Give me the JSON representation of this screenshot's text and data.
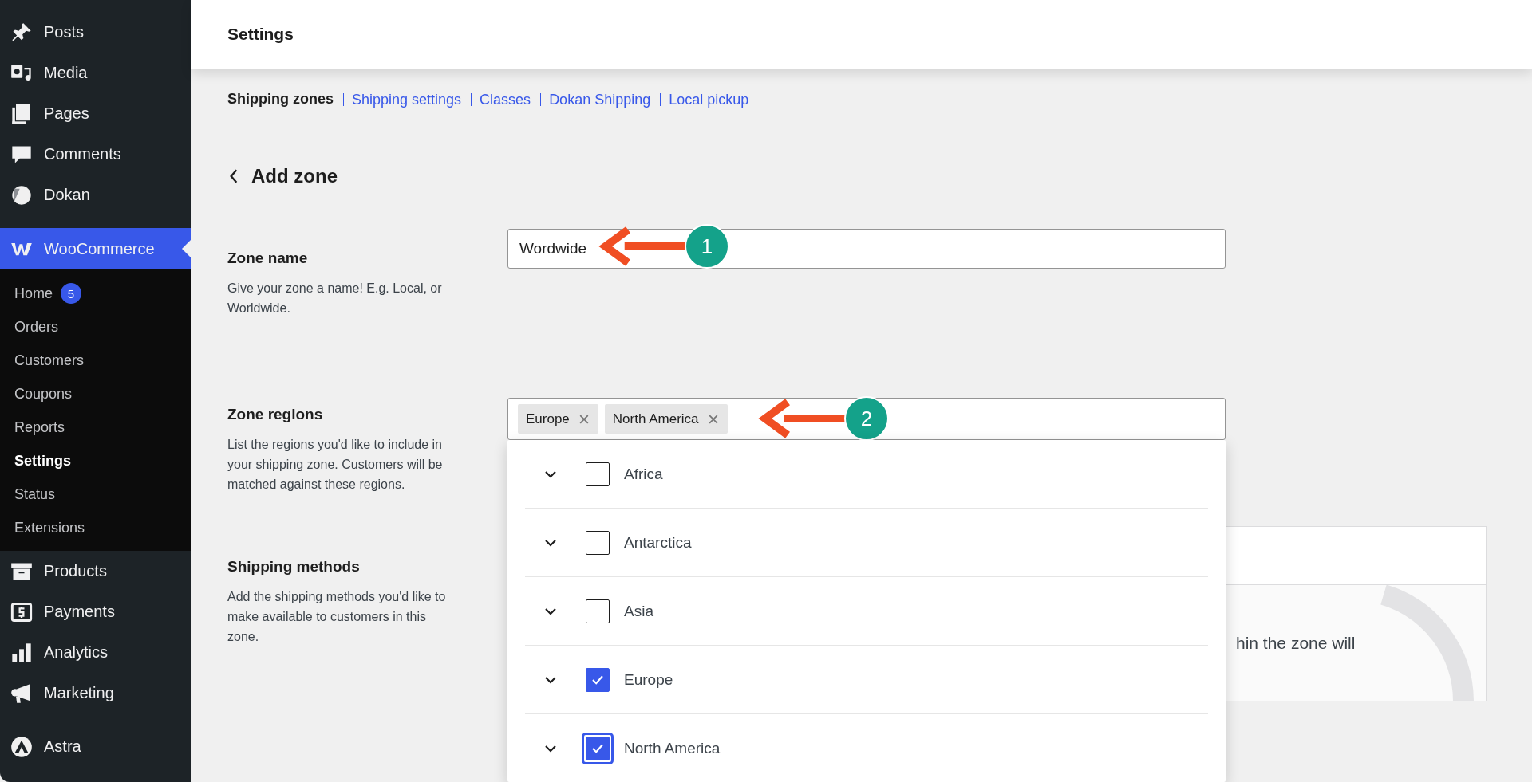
{
  "sidebar": {
    "items": [
      {
        "label": "Posts",
        "selected": false
      },
      {
        "label": "Media",
        "selected": false
      },
      {
        "label": "Pages",
        "selected": false
      },
      {
        "label": "Comments",
        "selected": false
      },
      {
        "label": "Dokan",
        "selected": false
      },
      {
        "label": "WooCommerce",
        "selected": true,
        "children": [
          {
            "label": "Home",
            "badge": "5",
            "selected": false
          },
          {
            "label": "Orders",
            "selected": false
          },
          {
            "label": "Customers",
            "selected": false
          },
          {
            "label": "Coupons",
            "selected": false
          },
          {
            "label": "Reports",
            "selected": false
          },
          {
            "label": "Settings",
            "selected": true
          },
          {
            "label": "Status",
            "selected": false
          },
          {
            "label": "Extensions",
            "selected": false
          }
        ]
      },
      {
        "label": "Products",
        "selected": false
      },
      {
        "label": "Payments",
        "selected": false
      },
      {
        "label": "Analytics",
        "selected": false
      },
      {
        "label": "Marketing",
        "selected": false
      },
      {
        "label": "Astra",
        "selected": false
      }
    ]
  },
  "header": {
    "title": "Settings"
  },
  "tabs": [
    {
      "label": "Shipping zones",
      "selected": true
    },
    {
      "label": "Shipping settings",
      "selected": false
    },
    {
      "label": "Classes",
      "selected": false
    },
    {
      "label": "Dokan Shipping",
      "selected": false
    },
    {
      "label": "Local pickup",
      "selected": false
    }
  ],
  "page_title": "Add zone",
  "zone_name": {
    "label": "Zone name",
    "description": "Give your zone a name! E.g. Local, or Worldwide.",
    "value": "Wordwide",
    "callout": "1"
  },
  "zone_regions": {
    "label": "Zone regions",
    "description": "List the regions you'd like to include in your shipping zone. Customers will be matched against these regions.",
    "tags": [
      "Europe",
      "North America"
    ],
    "callout": "2",
    "options": [
      {
        "label": "Africa",
        "checked": false,
        "focused": false
      },
      {
        "label": "Antarctica",
        "checked": false,
        "focused": false
      },
      {
        "label": "Asia",
        "checked": false,
        "focused": false
      },
      {
        "label": "Europe",
        "checked": true,
        "focused": false
      },
      {
        "label": "North America",
        "checked": true,
        "focused": true
      }
    ]
  },
  "shipping_methods": {
    "label": "Shipping methods",
    "description": "Add the shipping methods you'd like to make available to customers in this zone.",
    "table_text": "hin the zone will"
  }
}
